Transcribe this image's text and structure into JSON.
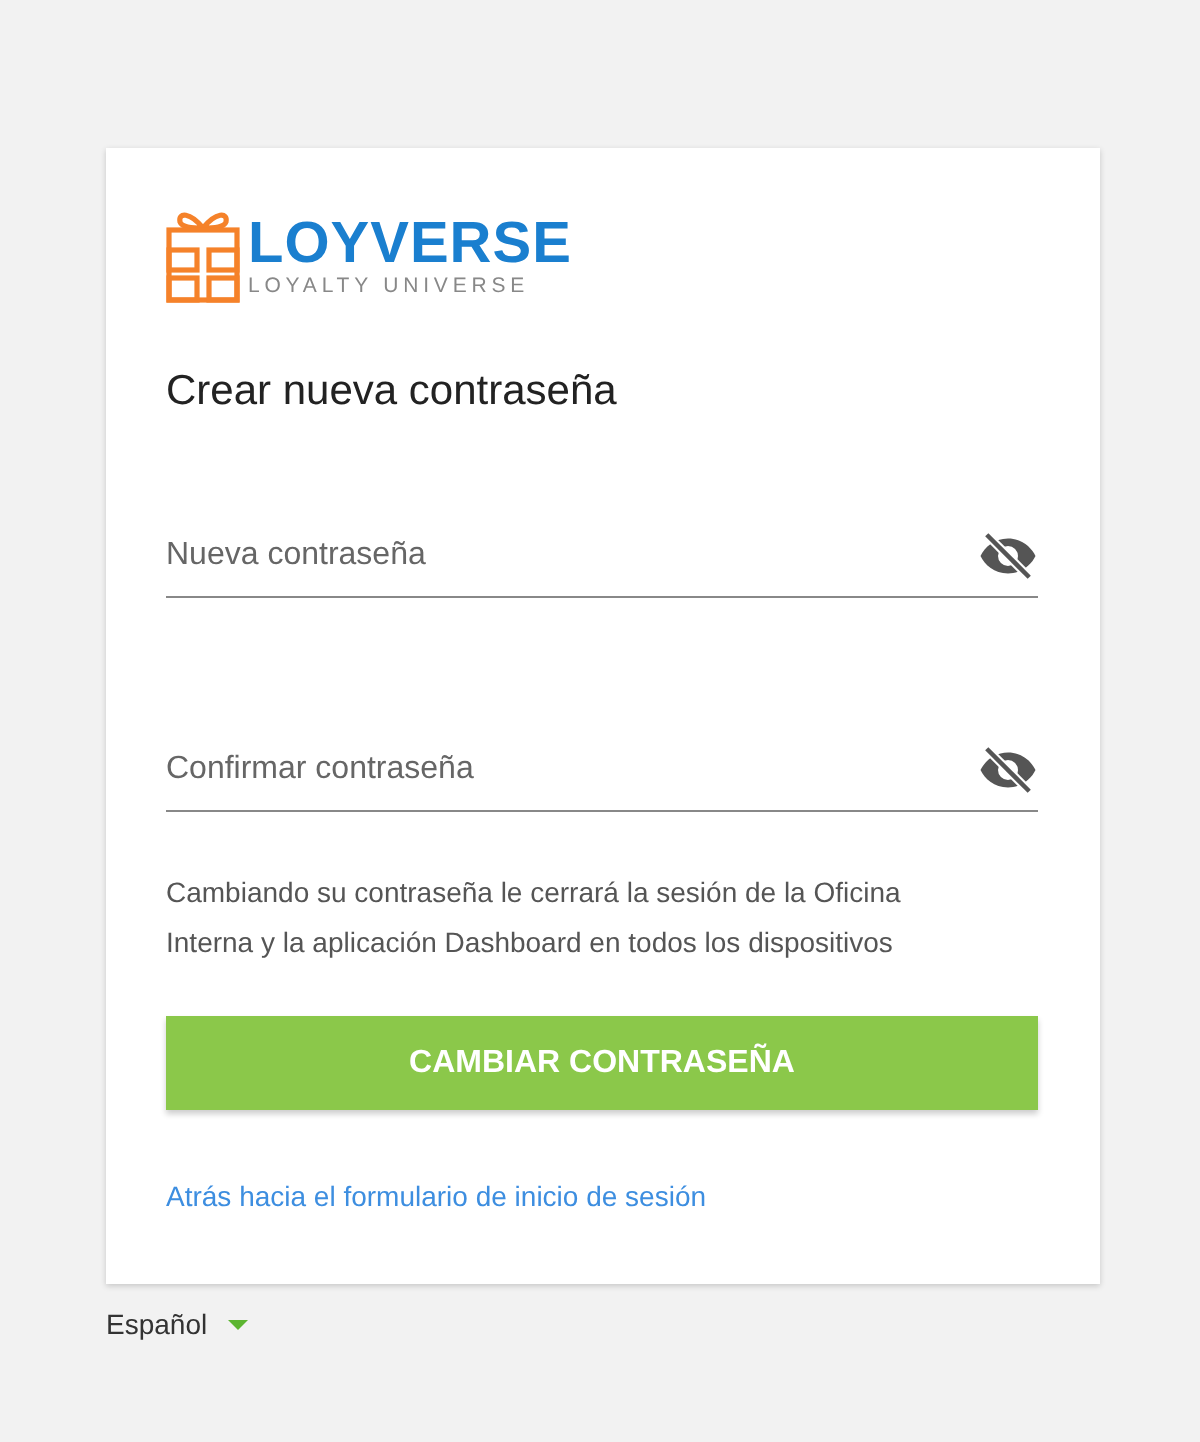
{
  "logo": {
    "name": "LOYVERSE",
    "tagline": "LOYALTY UNIVERSE"
  },
  "title": "Crear nueva contraseña",
  "fields": [
    {
      "placeholder": "Nueva contraseña"
    },
    {
      "placeholder": "Confirmar contraseña"
    }
  ],
  "note": "Cambiando su contraseña le cerrará la sesión de la Oficina Interna y la aplicación Dashboard en todos los dispositivos",
  "submit_button": "CAMBIAR CONTRASEÑA",
  "back_link": "Atrás hacia el formulario de inicio de sesión",
  "language": "Español"
}
